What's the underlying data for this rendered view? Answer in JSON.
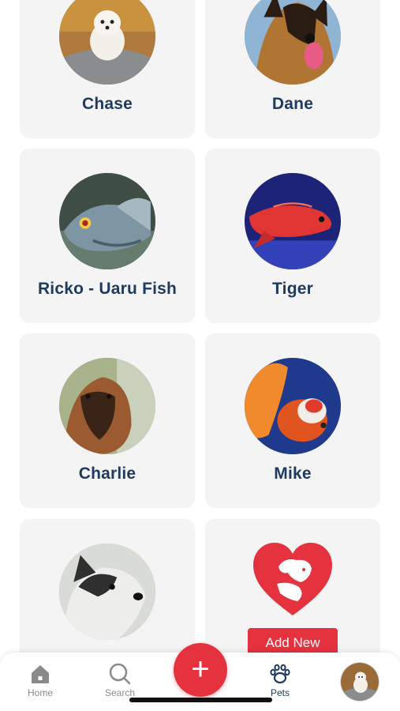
{
  "pets": [
    {
      "name": "Chase"
    },
    {
      "name": "Dane"
    },
    {
      "name": "Ricko - Uaru Fish"
    },
    {
      "name": "Tiger"
    },
    {
      "name": "Charlie"
    },
    {
      "name": "Mike"
    },
    {
      "name": ""
    }
  ],
  "add_card": {
    "button_label": "Add New",
    "icon": "heart-pets-icon"
  },
  "tabbar": {
    "home": {
      "label": "Home",
      "icon": "home-icon"
    },
    "search": {
      "label": "Search",
      "icon": "search-icon"
    },
    "add": {
      "label": "+",
      "icon": "plus-icon"
    },
    "pets": {
      "label": "Pets",
      "icon": "paw-icon"
    },
    "profile": {
      "icon": "avatar"
    }
  },
  "colors": {
    "accent": "#e5323f",
    "text": "#1e3a5f",
    "card_bg": "#f4f4f5",
    "inactive": "#8a8a8a"
  }
}
